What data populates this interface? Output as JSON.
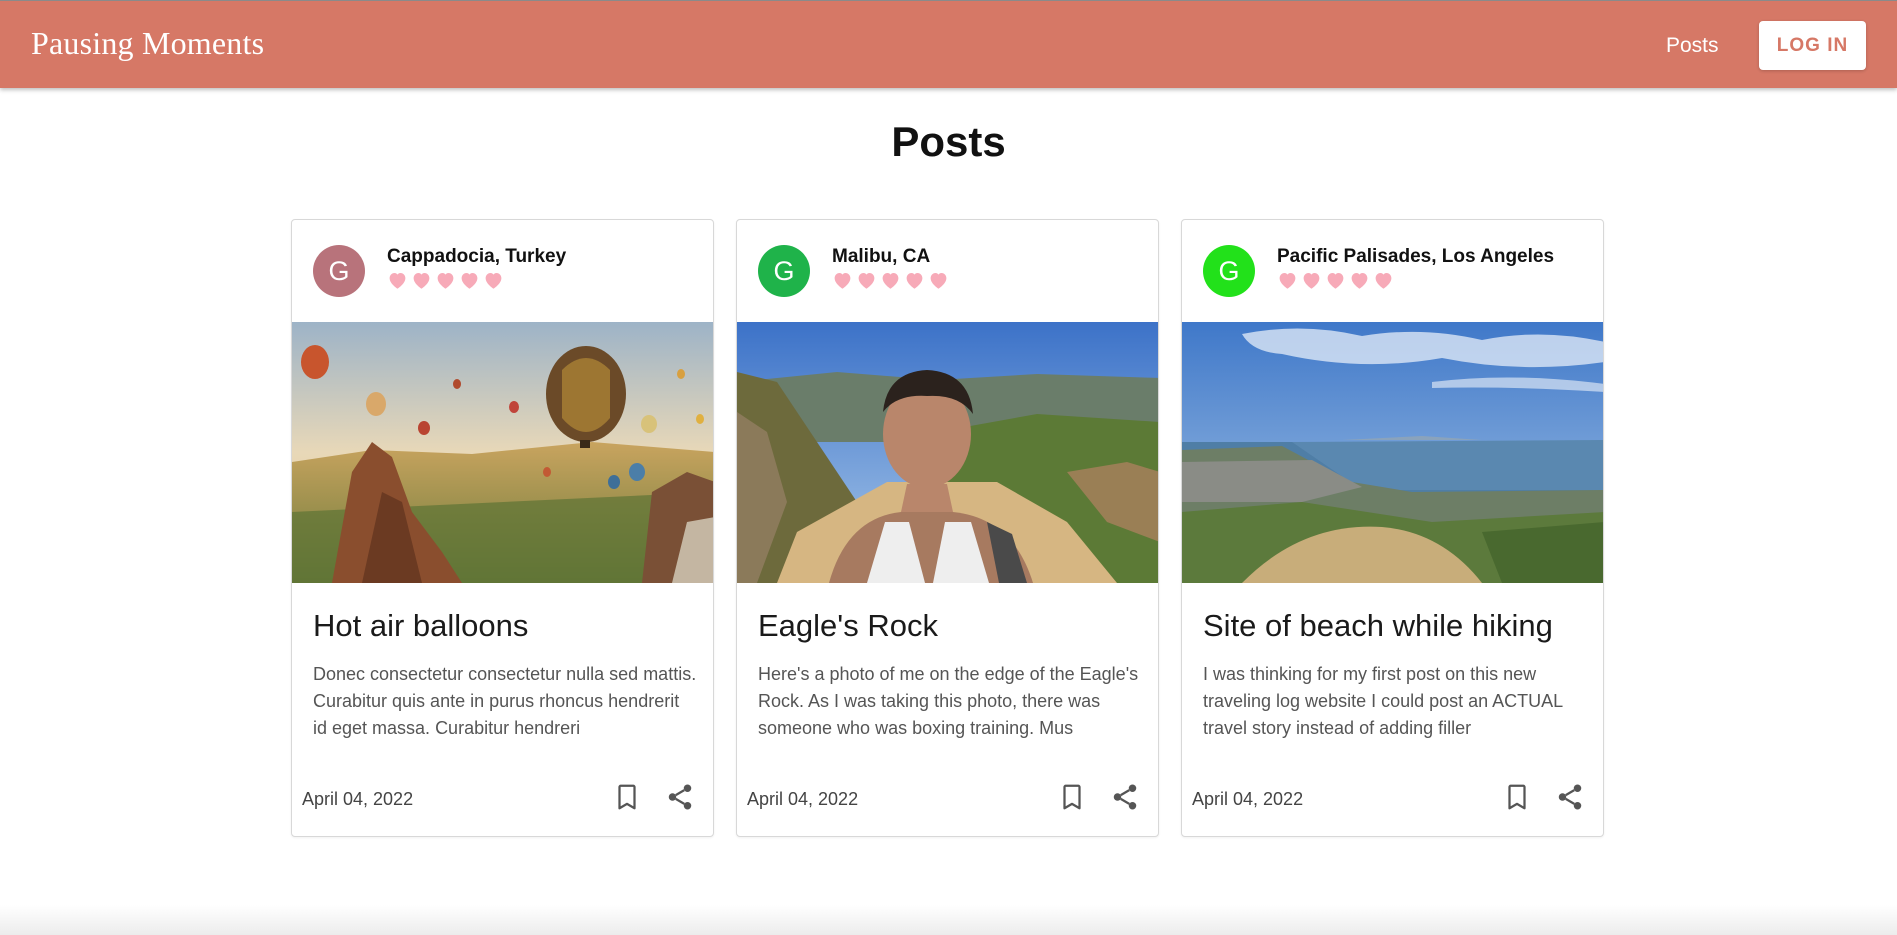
{
  "app": {
    "brand": "Pausing Moments",
    "nav_posts": "Posts",
    "login_label": "LOG IN",
    "accent_color": "#d67866"
  },
  "page_title": "Posts",
  "posts": [
    {
      "avatar_letter": "G",
      "avatar_color": "#b8737b",
      "location": "Cappadocia, Turkey",
      "hearts": 5,
      "image": "hot-air-balloons-photo",
      "title": "Hot air balloons",
      "excerpt": "Donec consectetur consectetur nulla sed mattis. Curabitur quis ante in purus rhoncus hendrerit id eget massa. Curabitur hendreri",
      "date": "April 04, 2022"
    },
    {
      "avatar_letter": "G",
      "avatar_color": "#1fb34a",
      "location": "Malibu, CA",
      "hearts": 5,
      "image": "eagles-rock-selfie-photo",
      "title": "Eagle's Rock",
      "excerpt": "Here's a photo of me on the edge of the Eagle's Rock. As I was taking this photo, there was someone who was boxing training. Mus",
      "date": "April 04, 2022"
    },
    {
      "avatar_letter": "G",
      "avatar_color": "#22e11a",
      "location": "Pacific Palisades, Los Angeles",
      "hearts": 5,
      "image": "beach-hiking-view-photo",
      "title": "Site of beach while hiking",
      "excerpt": "I was thinking for my first post on this new traveling log website I could post an ACTUAL travel story instead of adding filler",
      "date": "April 04, 2022"
    }
  ],
  "icons": {
    "heart": "heart-icon",
    "bookmark": "bookmark-icon",
    "share": "share-icon",
    "heart_color": "#f7aab8"
  }
}
